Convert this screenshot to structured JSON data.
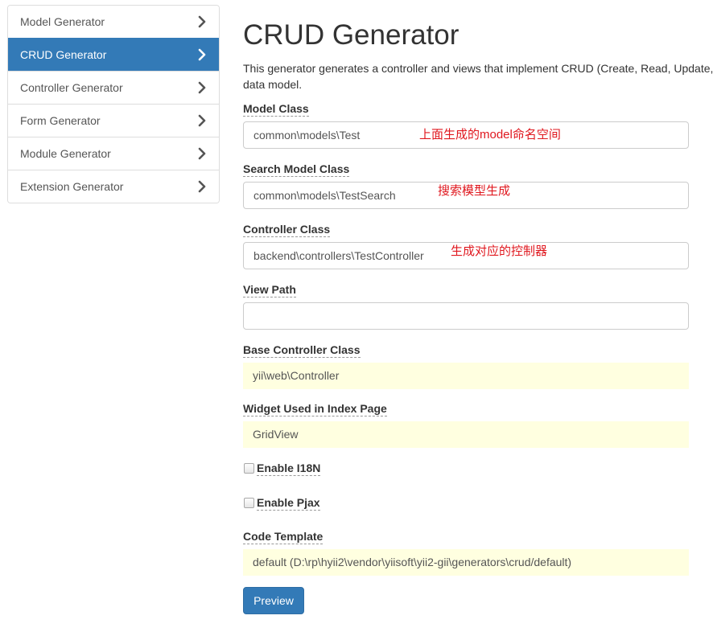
{
  "sidebar": {
    "items": [
      {
        "label": "Model Generator",
        "active": false
      },
      {
        "label": "CRUD Generator",
        "active": true
      },
      {
        "label": "Controller Generator",
        "active": false
      },
      {
        "label": "Form Generator",
        "active": false
      },
      {
        "label": "Module Generator",
        "active": false
      },
      {
        "label": "Extension Generator",
        "active": false
      }
    ],
    "item_icon": "chevron-right-icon"
  },
  "page": {
    "title": "CRUD Generator",
    "description_line1": "This generator generates a controller and views that implement CRUD (Create, Read, Update, Delete) operations for the specified",
    "description_line2": "data model."
  },
  "form": {
    "model_class": {
      "label": "Model Class",
      "value": "common\\models\\Test",
      "annotation": "上面生成的model命名空间"
    },
    "search_model_class": {
      "label": "Search Model Class",
      "value": "common\\models\\TestSearch",
      "annotation": "搜索模型生成"
    },
    "controller_class": {
      "label": "Controller Class",
      "value": "backend\\controllers\\TestController",
      "annotation": "生成对应的控制器"
    },
    "view_path": {
      "label": "View Path",
      "value": ""
    },
    "base_controller_class": {
      "label": "Base Controller Class",
      "value": "yii\\web\\Controller"
    },
    "widget": {
      "label": "Widget Used in Index Page",
      "value": "GridView"
    },
    "enable_i18n": {
      "label": "Enable I18N",
      "checked": false
    },
    "enable_pjax": {
      "label": "Enable Pjax",
      "checked": false
    },
    "code_template": {
      "label": "Code Template",
      "value": "default (D:\\rp\\hyii2\\vendor\\yiisoft\\yii2-gii\\generators\\crud/default)"
    },
    "preview_label": "Preview"
  },
  "colors": {
    "primary": "#337ab7",
    "sticky_bg": "#ffffe0",
    "annotation": "#e0181f"
  }
}
